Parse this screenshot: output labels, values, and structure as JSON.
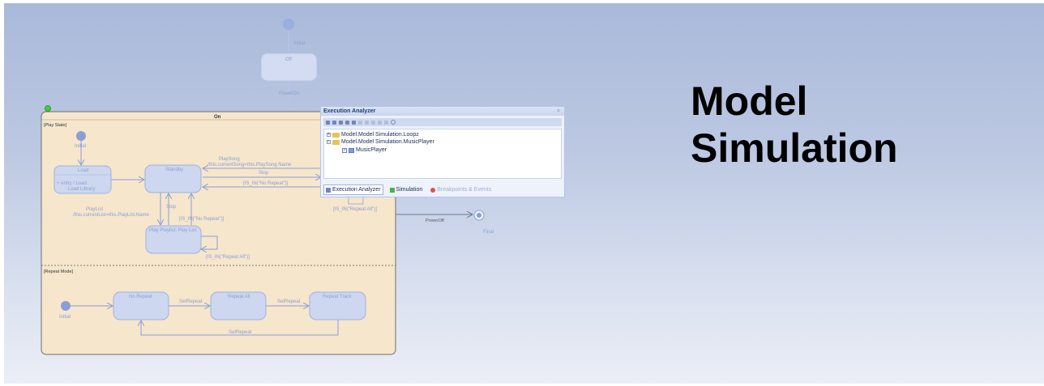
{
  "headline": {
    "line1": "Model",
    "line2": "Simulation"
  },
  "diagram": {
    "top_initial_label": "Initial",
    "off_state": "Off",
    "power_on": "PowerOn",
    "on_state": "On",
    "play_state_region": "[Play State]",
    "play_initial_label": "Initial",
    "load_state": "Load",
    "load_entry": "+ entry / Load",
    "load_exit": "Load Library",
    "standby_state": "Standby",
    "play_song_trigger": "PlaySong",
    "play_song_action": "/this.currentSong=this.PlaySong.Name",
    "stop_label_1": "Stop",
    "is_in_no_repeat_1": "[IS_IN(\"No Repeat\")]",
    "stop_label_2": "Stop",
    "play_list_trigger": "PlayList",
    "play_list_action": "/this.currentList=this.PlayList.Name",
    "is_in_no_repeat_2": "[IS_IN(\"No Repeat\")]",
    "play_playlist_state": "Play Playlist: Play List",
    "is_in_repeat_all_1": "[IS_IN(\"Repeat All\")]",
    "is_in_repeat_all_2": "[IS_IN(\"Repeat All\")]",
    "power_off": "PowerOff",
    "final_label": "Final",
    "repeat_mode_region": "[Repeat Mode]",
    "repeat_initial_label": "Initial",
    "no_repeat_state": "No Repeat",
    "repeat_all_state": "Repeat All",
    "repeat_track_state": "Repeat Track",
    "set_repeat_1": "SetRepeat",
    "set_repeat_2": "SetRepeat",
    "set_repeat_3": "SetRepeat"
  },
  "analyzer": {
    "title": "Execution Analyzer",
    "close": "×",
    "tree": [
      {
        "label": "Model.Model Simulation.Loopz",
        "expander": "+"
      },
      {
        "label": "Model.Model Simulation.MusicPlayer",
        "expander": "−"
      },
      {
        "label": "MusicPlayer",
        "checked": "✓"
      }
    ],
    "tabs": [
      {
        "label": "Execution Analyzer",
        "icon": "analyzer-icon"
      },
      {
        "label": "Simulation",
        "icon": "simulation-icon"
      },
      {
        "label": "Breakpoints & Events",
        "icon": "breakpoint-icon"
      }
    ]
  },
  "colors": {
    "state_fill": "#cbd5ee",
    "state_stroke": "#9fb1de",
    "composite_fill": "#f5e4c8",
    "node": "#8a9fd6",
    "selection_handle": "#3bd13b",
    "breakpoint": "#d9534f",
    "simulation_tab": "#4caf50"
  }
}
